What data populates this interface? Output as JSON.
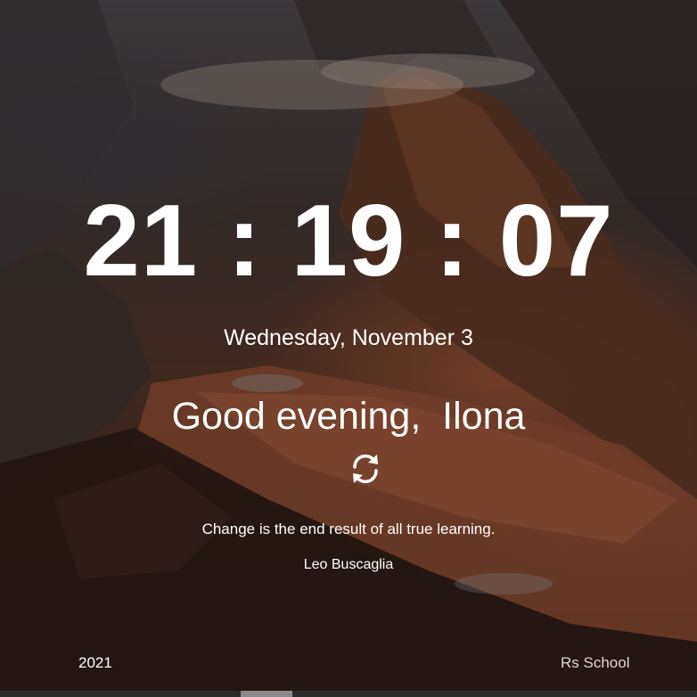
{
  "clock": {
    "hours": "21",
    "minutes": "19",
    "seconds": "07",
    "separator": ":"
  },
  "date": "Wednesday, November 3",
  "greeting": "Good evening,  Ilona",
  "refresh_icon": "refresh-icon",
  "quote": {
    "text": "Change is the end result of all true learning.",
    "author": "Leo Buscaglia"
  },
  "footer": {
    "year": "2021",
    "school": "Rs School"
  },
  "colors": {
    "text": "#ffffff",
    "footer_link": "#e0d6d0",
    "scrollbar_track": "#2a2e2a",
    "scrollbar_thumb": "#8a8a8a"
  }
}
